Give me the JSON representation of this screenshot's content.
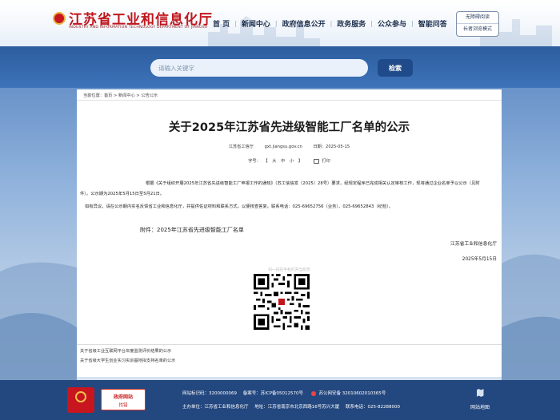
{
  "header": {
    "site_title": "江苏省工业和信息化厅",
    "site_subtitle": "INDUSTRY AND INFORMATION TECHNOLOGY DEPARTMENT OF JIANGSU",
    "nav": [
      "首 页",
      "新闻中心",
      "政府信息公开",
      "政务服务",
      "公众参与",
      "智能问答"
    ],
    "accessibility": "无障碍阅读",
    "elderly_mode": "长者浏览模式"
  },
  "search": {
    "placeholder": "请输入关键字",
    "button": "检索"
  },
  "article": {
    "breadcrumb": "当前位置：首页 > 新闻中心 > 公告公示",
    "title": "关于2025年江苏省先进级智能工厂名单的公示",
    "source": "江苏省工信厅",
    "site": "gxt.jiangsu.gov.cn",
    "date": "日期：2025-05-15",
    "font_label": "字号：",
    "font_sizes": [
      "【",
      "大",
      "中",
      "小",
      "】"
    ],
    "print": "打印",
    "paragraph1": "根据《关于组织开展2025年江苏省先进级智能工厂申报工作的通知》（苏工信信发〔2025〕28号）要求，经规定程序已完成相关认定审核工作，现将通过企业名单予以公示（见附件）。公示期为2025年5月15日至5月21日。",
    "paragraph2": "如有异议，请在公示期内实名反馈省工业和信息化厅，并提供佐证材料和联系方式，以便核查答复。联系电话：025-69652756（业务）、025-69652843（纪检）。",
    "attachment": "附件：2025年江苏省先进级智能工厂名单",
    "signature_org": "江苏省工业和信息化厅",
    "signature_date": "2025年5月15日",
    "qr_caption": "扫一扫在手机打开当前页"
  },
  "related": [
    "关于省级工业互联网平台年度监测评价结果的公示",
    "关于省级大学生创业实习实训基地拟支持名单的公示"
  ],
  "footer": {
    "gov_badge_1": "政府网站",
    "gov_badge_2": "找错",
    "line1_a": "网站标识码：3200000069",
    "line1_b": "备案号：苏ICP备05012570号",
    "line1_c": "苏公网安备 32010602010365号",
    "line2_a": "主办单位：江苏省工业和信息化厅",
    "line2_b": "地址：江苏省南京市北京西路16号苏兴大厦",
    "line2_c": "联系电话：025-82288000",
    "sitemap": "网站地图"
  },
  "colors": {
    "brand_red": "#c0161c",
    "band_blue": "#2c5d9f",
    "footer_blue": "#23477f"
  }
}
